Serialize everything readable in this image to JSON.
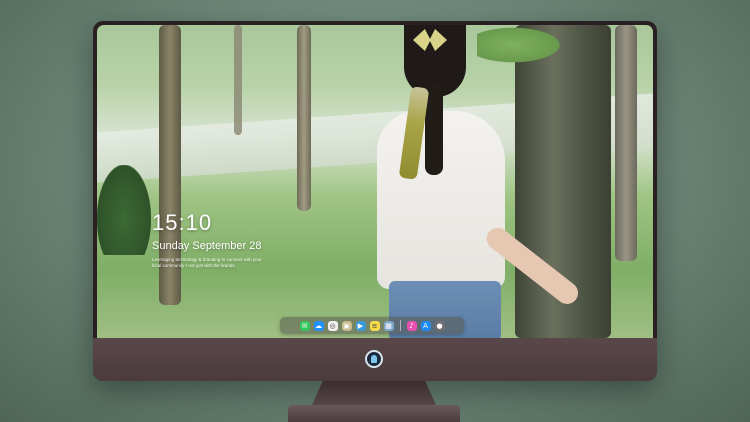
{
  "lock_screen": {
    "time": "15:10",
    "date": "Sunday September 28",
    "quote": "Leveraging technology & branding to connect with your local community • not just with the brands"
  },
  "dock": {
    "apps": [
      {
        "name": "messages-icon",
        "color": "#34c759",
        "glyph": "✉"
      },
      {
        "name": "finder-icon",
        "color": "#1e90ff",
        "glyph": "☁"
      },
      {
        "name": "safari-icon",
        "color": "#f2f2f2",
        "glyph": "◎"
      },
      {
        "name": "preview-icon",
        "color": "#c8b98a",
        "glyph": "▣"
      },
      {
        "name": "clapper-icon",
        "color": "#3a9ad9",
        "glyph": "▶"
      },
      {
        "name": "notes-icon",
        "color": "#f7d94c",
        "glyph": "≡"
      },
      {
        "name": "photos-icon",
        "color": "#7fa7c9",
        "glyph": "▦"
      },
      {
        "name": "itunes-icon",
        "color": "#e84fb0",
        "glyph": "♪"
      },
      {
        "name": "appstore-icon",
        "color": "#1f8bf0",
        "glyph": "A"
      },
      {
        "name": "camera-icon",
        "color": "#6e6e73",
        "glyph": "●"
      }
    ]
  },
  "colors": {
    "monitor_frame": "#2a1f22",
    "monitor_chin": "#4b3b3d",
    "background": "#6f8a7c"
  }
}
